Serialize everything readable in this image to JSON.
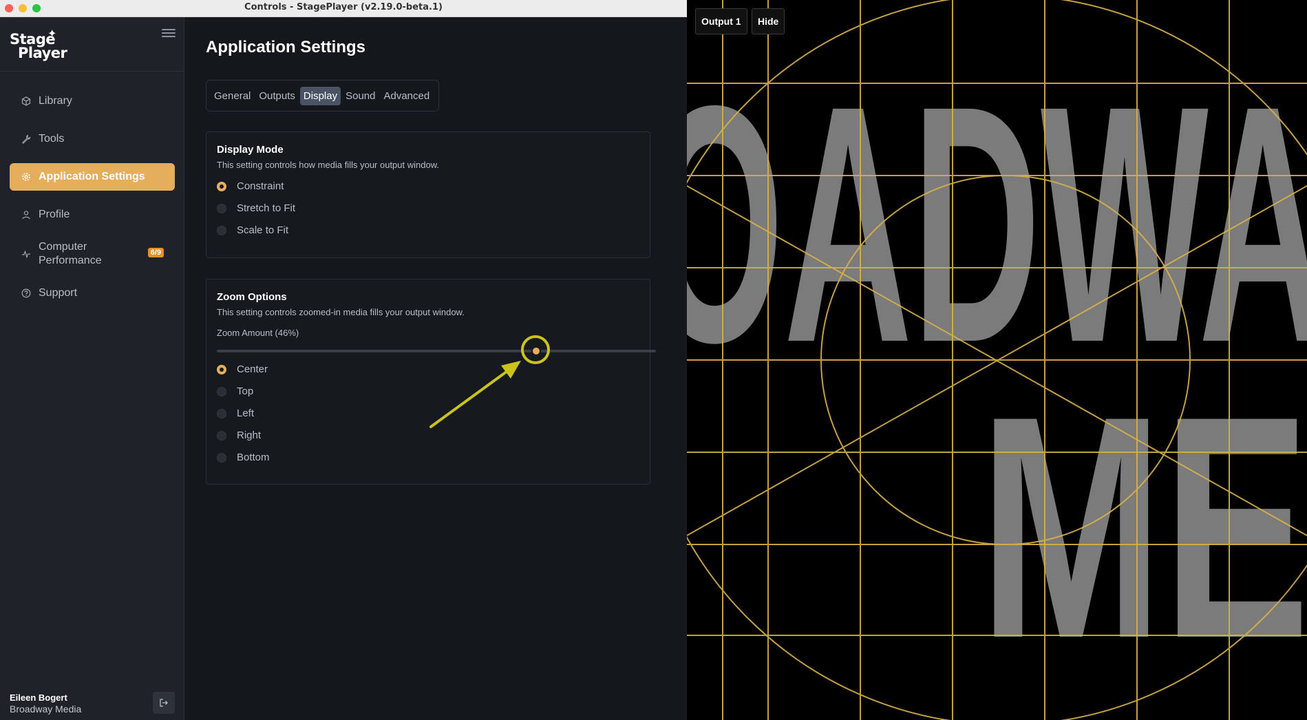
{
  "window": {
    "title": "Controls - StagePlayer (v2.19.0-beta.1)"
  },
  "logo": {
    "line1": "Stage",
    "line2": "Player"
  },
  "sidebar": {
    "items": [
      {
        "label": "Library",
        "icon": "cube-icon"
      },
      {
        "label": "Tools",
        "icon": "wrench-icon"
      },
      {
        "label": "Application Settings",
        "icon": "gear-icon",
        "active": true
      },
      {
        "label": "Profile",
        "icon": "user-icon"
      },
      {
        "label_line1": "Computer",
        "label_line2": "Performance",
        "badge": "6/9",
        "icon": "pulse-icon"
      },
      {
        "label": "Support",
        "icon": "help-circle-icon"
      }
    ],
    "user": {
      "name": "Eileen Bogert",
      "org": "Broadway Media"
    }
  },
  "main": {
    "title": "Application Settings",
    "tabs": [
      "General",
      "Outputs",
      "Display",
      "Sound",
      "Advanced"
    ],
    "active_tab": "Display",
    "display_mode": {
      "title": "Display Mode",
      "description": "This setting controls how media fills your output window.",
      "options": [
        "Constraint",
        "Stretch to Fit",
        "Scale to Fit"
      ],
      "selected": "Constraint"
    },
    "zoom": {
      "title": "Zoom Options",
      "description": "This setting controls zoomed-in media fills your output window.",
      "amount_label": "Zoom Amount (46%)",
      "amount_percent": 46,
      "slider_position_fraction": 0.727,
      "options": [
        "Center",
        "Top",
        "Left",
        "Right",
        "Bottom"
      ],
      "selected": "Center"
    }
  },
  "output": {
    "button_output": "Output 1",
    "button_hide": "Hide",
    "big_text_line1": "OADWA",
    "big_text_line2": "ME"
  },
  "colors": {
    "accent": "#e4ae5c",
    "badge": "#e3912b",
    "annotation": "#c9c31a",
    "grid": "#d9b24a",
    "sidebar_bg": "#1f2228",
    "main_bg": "#14171c"
  }
}
